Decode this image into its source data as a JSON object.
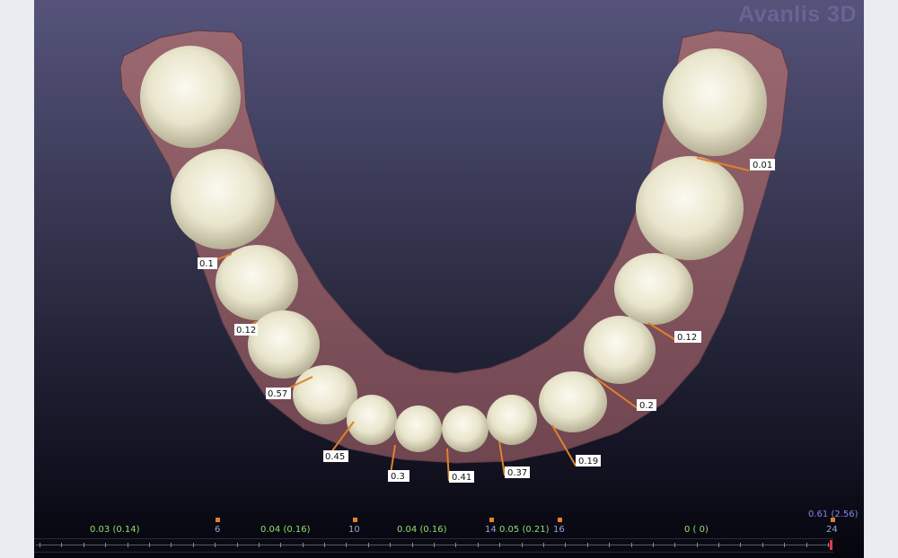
{
  "app": {
    "brand": "Avanlis 3D"
  },
  "colors": {
    "viewport_top": "#55537a",
    "viewport_bottom": "#05050d",
    "measure_line": "#e0822a",
    "gum": "#8a5a62",
    "tooth": "#ece8cf"
  },
  "icons": {
    "brand": "avanlis-logo"
  },
  "measurements": [
    "0.1",
    "0.12",
    "0.57",
    "0.45",
    "0.3",
    "0.41",
    "0.37",
    "0.19",
    "0.2",
    "0.12",
    "0.01"
  ],
  "timeline": {
    "segment_values": [
      "0.03 (0.14)",
      "0.04 (0.16)",
      "0.04 (0.16)",
      "0.05 (0.21)",
      "0 (   0)"
    ],
    "stage_numbers": [
      "6",
      "10",
      "14",
      "16",
      "24"
    ],
    "total_value": "0.61 (2.56)",
    "tick_count": 37
  }
}
